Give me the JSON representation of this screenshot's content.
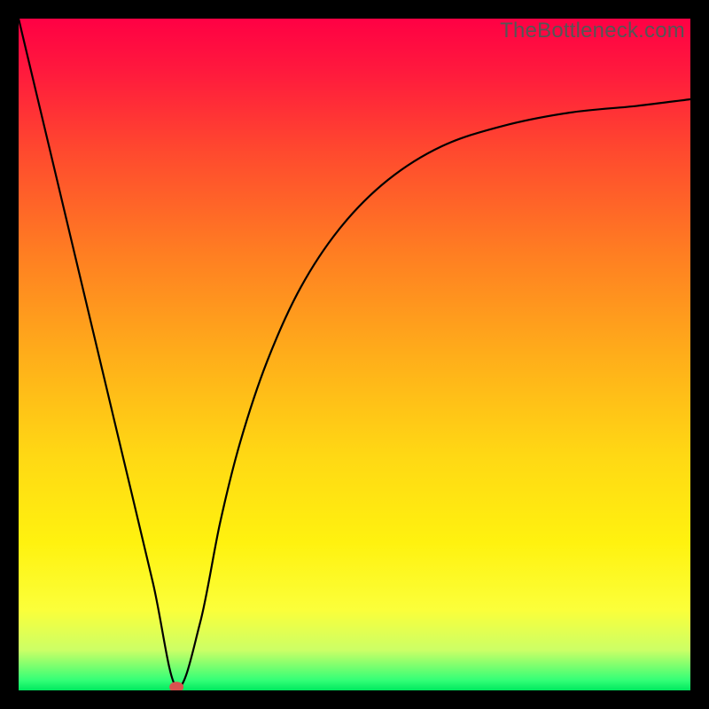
{
  "watermark": "TheBottleneck.com",
  "chart_data": {
    "type": "line",
    "title": "",
    "xlabel": "",
    "ylabel": "",
    "xlim": [
      0,
      100
    ],
    "ylim": [
      0,
      1
    ],
    "background_gradient": {
      "stops": [
        {
          "offset": 0,
          "color": "#ff0044"
        },
        {
          "offset": 0.08,
          "color": "#ff1a3d"
        },
        {
          "offset": 0.2,
          "color": "#ff4a2e"
        },
        {
          "offset": 0.35,
          "color": "#ff7e22"
        },
        {
          "offset": 0.5,
          "color": "#ffad1a"
        },
        {
          "offset": 0.65,
          "color": "#ffd814"
        },
        {
          "offset": 0.78,
          "color": "#fff20f"
        },
        {
          "offset": 0.88,
          "color": "#fbff3a"
        },
        {
          "offset": 0.94,
          "color": "#ccff66"
        },
        {
          "offset": 0.985,
          "color": "#33ff77"
        },
        {
          "offset": 1.0,
          "color": "#00e85e"
        }
      ]
    },
    "series": [
      {
        "name": "bottleneck-curve",
        "x": [
          0,
          5,
          10,
          15,
          20,
          23.5,
          27,
          30,
          33,
          37,
          42,
          48,
          55,
          63,
          72,
          82,
          92,
          100
        ],
        "y": [
          1.0,
          0.79,
          0.58,
          0.37,
          0.16,
          0.005,
          0.1,
          0.25,
          0.37,
          0.49,
          0.6,
          0.69,
          0.76,
          0.81,
          0.84,
          0.86,
          0.87,
          0.88
        ]
      }
    ],
    "marker": {
      "x": 23.5,
      "y": 0.005,
      "color": "#d9534f"
    }
  }
}
